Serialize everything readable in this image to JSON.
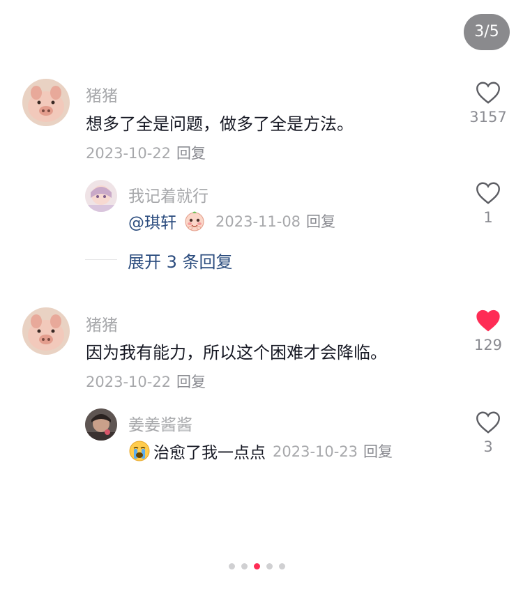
{
  "pager": {
    "label": "3/5"
  },
  "comments": [
    {
      "username": "猪猪",
      "text": "想多了全是问题，做多了全是方法。",
      "date": "2023-10-22",
      "reply_label": "回复",
      "likes": "3157",
      "liked": false,
      "replies": [
        {
          "username": "我记着就行",
          "mention": "@琪轩",
          "emoji": "shy-face-emoji",
          "date": "2023-11-08",
          "reply_label": "回复",
          "likes": "1",
          "liked": false
        }
      ],
      "expand_label": "展开 3 条回复"
    },
    {
      "username": "猪猪",
      "text": "因为我有能力，所以这个困难才会降临。",
      "date": "2023-10-22",
      "reply_label": "回复",
      "likes": "129",
      "liked": true,
      "replies": [
        {
          "username": "姜姜酱酱",
          "emoji": "crying-face-emoji",
          "text": "治愈了我一点点",
          "date": "2023-10-23",
          "reply_label": "回复",
          "likes": "3",
          "liked": false
        }
      ]
    }
  ],
  "carousel": {
    "total": 5,
    "active_index": 2
  },
  "colors": {
    "accent_like": "#fe2c55",
    "link": "#2b4c7e",
    "muted": "#a7a8ab"
  }
}
